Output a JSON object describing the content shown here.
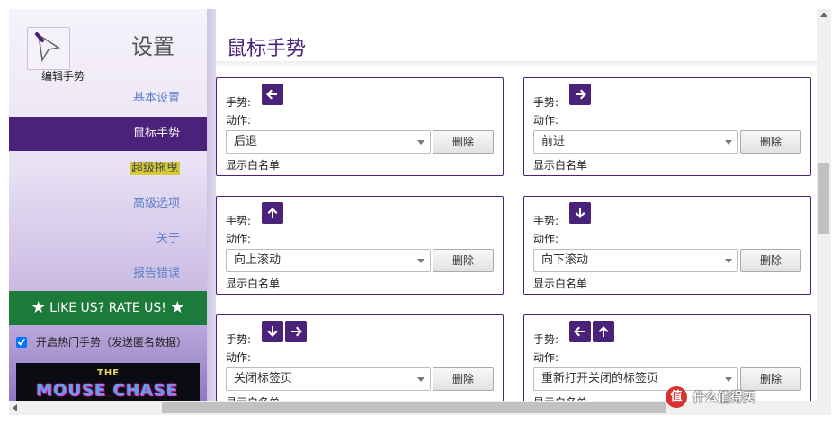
{
  "sidebar": {
    "title": "设置",
    "subtitle": "编辑手势",
    "items": [
      {
        "label": "基本设置",
        "active": false
      },
      {
        "label": "鼠标手势",
        "active": true
      },
      {
        "label": "超级拖曳",
        "active": false,
        "highlighted": true
      },
      {
        "label": "高级选项",
        "active": false
      },
      {
        "label": "关于",
        "active": false
      },
      {
        "label": "报告错误",
        "active": false
      }
    ],
    "rate_label": "LIKE US? RATE US!",
    "hot_gestures_label": "开启热门手势（发送匿名数据）",
    "hot_gestures_checked": true,
    "promo": {
      "line1": "THE",
      "line2": "MOUSE CHASE"
    }
  },
  "main": {
    "title": "鼠标手势",
    "labels": {
      "gesture": "手势:",
      "action": "动作:",
      "delete": "删除",
      "whitelist": "显示白名单"
    },
    "cards": [
      {
        "arrows": [
          "left-arrow-icon"
        ],
        "action": "后退"
      },
      {
        "arrows": [
          "right-arrow-icon"
        ],
        "action": "前进"
      },
      {
        "arrows": [
          "up-arrow-icon"
        ],
        "action": "向上滚动"
      },
      {
        "arrows": [
          "down-arrow-icon"
        ],
        "action": "向下滚动"
      },
      {
        "arrows": [
          "down-arrow-icon",
          "right-arrow-icon"
        ],
        "action": "关闭标签页"
      },
      {
        "arrows": [
          "left-arrow-icon",
          "up-arrow-icon"
        ],
        "action": "重新打开关闭的标签页"
      }
    ]
  },
  "watermark": {
    "logo": "值",
    "text": "什么值得买"
  },
  "colors": {
    "accent": "#4a2279",
    "rate_bar": "#1c7a3a",
    "highlight": "#d6c93a",
    "link": "#5d7fc9"
  }
}
